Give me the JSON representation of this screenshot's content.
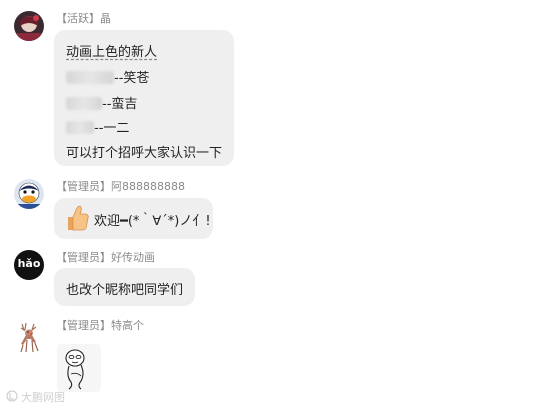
{
  "messages": [
    {
      "sender_tag": "【活跃】",
      "sender_name": "晶",
      "avatar_icon": "dark-anime-avatar-icon",
      "lines": {
        "l1": "动画上色的新人",
        "l2": "--笑苍",
        "l3": "--蛮吉",
        "l4": "--一二",
        "l5": "可以打个招呼大家认识一下"
      }
    },
    {
      "sender_tag": "【管理员】",
      "sender_name": "阿888888888",
      "avatar_icon": "cartoon-duck-avatar-icon",
      "emoji_icon": "thumbs-up-icon",
      "text": "欢迎━(*｀∀´*)ノ亻!"
    },
    {
      "sender_tag": "【管理员】",
      "sender_name": "好传动画",
      "avatar_icon": "hao-logo-avatar-icon",
      "avatar_text": "hǎo",
      "text": "也改个昵称吧同学们"
    },
    {
      "sender_tag": "【管理员】",
      "sender_name": "特高个",
      "avatar_icon": "deer-avatar-icon",
      "sticker_icon": "doodle-character-sticker-icon"
    }
  ],
  "watermark": {
    "icon": "watermark-logo-icon",
    "text": "大鹏网图"
  }
}
